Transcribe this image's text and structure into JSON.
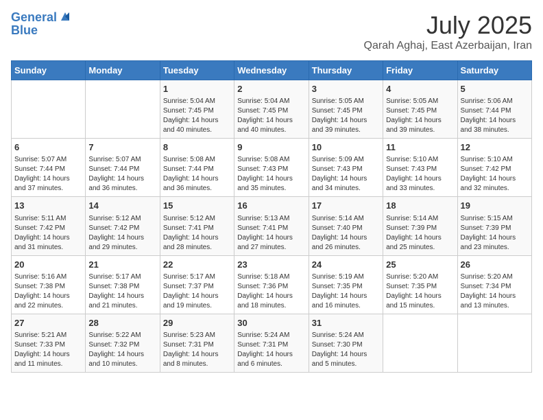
{
  "logo": {
    "line1": "General",
    "line2": "Blue"
  },
  "title": "July 2025",
  "subtitle": "Qarah Aghaj, East Azerbaijan, Iran",
  "headers": [
    "Sunday",
    "Monday",
    "Tuesday",
    "Wednesday",
    "Thursday",
    "Friday",
    "Saturday"
  ],
  "weeks": [
    [
      {
        "day": "",
        "sunrise": "",
        "sunset": "",
        "daylight": ""
      },
      {
        "day": "",
        "sunrise": "",
        "sunset": "",
        "daylight": ""
      },
      {
        "day": "1",
        "sunrise": "Sunrise: 5:04 AM",
        "sunset": "Sunset: 7:45 PM",
        "daylight": "Daylight: 14 hours and 40 minutes."
      },
      {
        "day": "2",
        "sunrise": "Sunrise: 5:04 AM",
        "sunset": "Sunset: 7:45 PM",
        "daylight": "Daylight: 14 hours and 40 minutes."
      },
      {
        "day": "3",
        "sunrise": "Sunrise: 5:05 AM",
        "sunset": "Sunset: 7:45 PM",
        "daylight": "Daylight: 14 hours and 39 minutes."
      },
      {
        "day": "4",
        "sunrise": "Sunrise: 5:05 AM",
        "sunset": "Sunset: 7:45 PM",
        "daylight": "Daylight: 14 hours and 39 minutes."
      },
      {
        "day": "5",
        "sunrise": "Sunrise: 5:06 AM",
        "sunset": "Sunset: 7:44 PM",
        "daylight": "Daylight: 14 hours and 38 minutes."
      }
    ],
    [
      {
        "day": "6",
        "sunrise": "Sunrise: 5:07 AM",
        "sunset": "Sunset: 7:44 PM",
        "daylight": "Daylight: 14 hours and 37 minutes."
      },
      {
        "day": "7",
        "sunrise": "Sunrise: 5:07 AM",
        "sunset": "Sunset: 7:44 PM",
        "daylight": "Daylight: 14 hours and 36 minutes."
      },
      {
        "day": "8",
        "sunrise": "Sunrise: 5:08 AM",
        "sunset": "Sunset: 7:44 PM",
        "daylight": "Daylight: 14 hours and 36 minutes."
      },
      {
        "day": "9",
        "sunrise": "Sunrise: 5:08 AM",
        "sunset": "Sunset: 7:43 PM",
        "daylight": "Daylight: 14 hours and 35 minutes."
      },
      {
        "day": "10",
        "sunrise": "Sunrise: 5:09 AM",
        "sunset": "Sunset: 7:43 PM",
        "daylight": "Daylight: 14 hours and 34 minutes."
      },
      {
        "day": "11",
        "sunrise": "Sunrise: 5:10 AM",
        "sunset": "Sunset: 7:43 PM",
        "daylight": "Daylight: 14 hours and 33 minutes."
      },
      {
        "day": "12",
        "sunrise": "Sunrise: 5:10 AM",
        "sunset": "Sunset: 7:42 PM",
        "daylight": "Daylight: 14 hours and 32 minutes."
      }
    ],
    [
      {
        "day": "13",
        "sunrise": "Sunrise: 5:11 AM",
        "sunset": "Sunset: 7:42 PM",
        "daylight": "Daylight: 14 hours and 31 minutes."
      },
      {
        "day": "14",
        "sunrise": "Sunrise: 5:12 AM",
        "sunset": "Sunset: 7:42 PM",
        "daylight": "Daylight: 14 hours and 29 minutes."
      },
      {
        "day": "15",
        "sunrise": "Sunrise: 5:12 AM",
        "sunset": "Sunset: 7:41 PM",
        "daylight": "Daylight: 14 hours and 28 minutes."
      },
      {
        "day": "16",
        "sunrise": "Sunrise: 5:13 AM",
        "sunset": "Sunset: 7:41 PM",
        "daylight": "Daylight: 14 hours and 27 minutes."
      },
      {
        "day": "17",
        "sunrise": "Sunrise: 5:14 AM",
        "sunset": "Sunset: 7:40 PM",
        "daylight": "Daylight: 14 hours and 26 minutes."
      },
      {
        "day": "18",
        "sunrise": "Sunrise: 5:14 AM",
        "sunset": "Sunset: 7:39 PM",
        "daylight": "Daylight: 14 hours and 25 minutes."
      },
      {
        "day": "19",
        "sunrise": "Sunrise: 5:15 AM",
        "sunset": "Sunset: 7:39 PM",
        "daylight": "Daylight: 14 hours and 23 minutes."
      }
    ],
    [
      {
        "day": "20",
        "sunrise": "Sunrise: 5:16 AM",
        "sunset": "Sunset: 7:38 PM",
        "daylight": "Daylight: 14 hours and 22 minutes."
      },
      {
        "day": "21",
        "sunrise": "Sunrise: 5:17 AM",
        "sunset": "Sunset: 7:38 PM",
        "daylight": "Daylight: 14 hours and 21 minutes."
      },
      {
        "day": "22",
        "sunrise": "Sunrise: 5:17 AM",
        "sunset": "Sunset: 7:37 PM",
        "daylight": "Daylight: 14 hours and 19 minutes."
      },
      {
        "day": "23",
        "sunrise": "Sunrise: 5:18 AM",
        "sunset": "Sunset: 7:36 PM",
        "daylight": "Daylight: 14 hours and 18 minutes."
      },
      {
        "day": "24",
        "sunrise": "Sunrise: 5:19 AM",
        "sunset": "Sunset: 7:35 PM",
        "daylight": "Daylight: 14 hours and 16 minutes."
      },
      {
        "day": "25",
        "sunrise": "Sunrise: 5:20 AM",
        "sunset": "Sunset: 7:35 PM",
        "daylight": "Daylight: 14 hours and 15 minutes."
      },
      {
        "day": "26",
        "sunrise": "Sunrise: 5:20 AM",
        "sunset": "Sunset: 7:34 PM",
        "daylight": "Daylight: 14 hours and 13 minutes."
      }
    ],
    [
      {
        "day": "27",
        "sunrise": "Sunrise: 5:21 AM",
        "sunset": "Sunset: 7:33 PM",
        "daylight": "Daylight: 14 hours and 11 minutes."
      },
      {
        "day": "28",
        "sunrise": "Sunrise: 5:22 AM",
        "sunset": "Sunset: 7:32 PM",
        "daylight": "Daylight: 14 hours and 10 minutes."
      },
      {
        "day": "29",
        "sunrise": "Sunrise: 5:23 AM",
        "sunset": "Sunset: 7:31 PM",
        "daylight": "Daylight: 14 hours and 8 minutes."
      },
      {
        "day": "30",
        "sunrise": "Sunrise: 5:24 AM",
        "sunset": "Sunset: 7:31 PM",
        "daylight": "Daylight: 14 hours and 6 minutes."
      },
      {
        "day": "31",
        "sunrise": "Sunrise: 5:24 AM",
        "sunset": "Sunset: 7:30 PM",
        "daylight": "Daylight: 14 hours and 5 minutes."
      },
      {
        "day": "",
        "sunrise": "",
        "sunset": "",
        "daylight": ""
      },
      {
        "day": "",
        "sunrise": "",
        "sunset": "",
        "daylight": ""
      }
    ]
  ]
}
